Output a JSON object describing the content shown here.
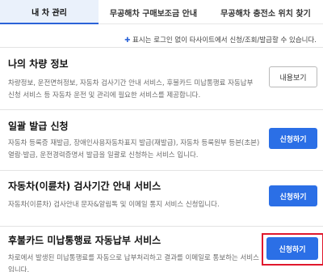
{
  "tabs": [
    {
      "label": "내 차 관리",
      "active": true
    },
    {
      "label": "무공해차 구매보조금 안내",
      "active": false
    },
    {
      "label": "무공해차 충전소 위치 찾기",
      "active": false
    }
  ],
  "notice": {
    "mark": "✚",
    "text": " 표시는 로그인 없이 타사이트에서 신청/조회/발급할 수 있습니다."
  },
  "sections": [
    {
      "title": "나의 차량 정보",
      "desc": "차량정보, 운전면허정보, 자동차 검사기간 안내 서비스, 후불카드 미납통행료 자동납부 신청 서비스 등 자동차 운전 및 관리에 필요한 서비스를 제공합니다.",
      "button": "내용보기"
    },
    {
      "title": "일괄 발급 신청",
      "desc": "자동차 등록증 재발급, 장애인사용자동차표지 발급(재발급), 자동차 등록원부 등본(초본) 열람·발급, 운전경력증명서 발급을 일괄로 신청하는 서비스 입니다.",
      "button": "신청하기"
    },
    {
      "title": "자동차(이륜차) 검사기간 안내 서비스",
      "desc": "자동차(이륜차) 검사안내 문자&알림톡 및 이메일 통지 서비스 신청입니다.",
      "button": "신청하기"
    },
    {
      "title": "후불카드 미납통행료 자동납부 서비스",
      "desc": "차로에서 발생된 미납통행료를 자동으로 납부처리하고 결과를 이메일로 통보하는 서비스입니다.",
      "button": "신청하기"
    }
  ],
  "colors": {
    "accent": "#2b6fe6",
    "highlight": "#e0182d"
  }
}
